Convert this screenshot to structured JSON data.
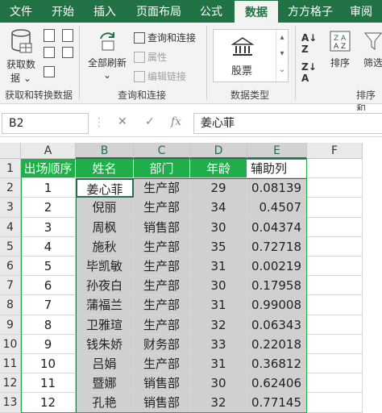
{
  "tabs": [
    "文件",
    "开始",
    "插入",
    "页面布局",
    "公式",
    "数据",
    "方方格子",
    "审阅"
  ],
  "active_tab": "数据",
  "ribbon": {
    "get_data_label1": "获取数",
    "get_data_label2": "据",
    "refresh_label": "全部刷新",
    "query_conn": "查询和连接",
    "properties": "属性",
    "edit_links": "编辑链接",
    "stock_label": "股票",
    "sort_label": "排序",
    "filter_label": "筛选",
    "group1": "获取和转换数据",
    "group2": "查询和连接",
    "group3": "数据类型",
    "group4": "排序和"
  },
  "formula_bar": {
    "name_box": "B2",
    "fx": "fx",
    "content": "姜心菲"
  },
  "columns": [
    "A",
    "B",
    "C",
    "D",
    "E",
    "F"
  ],
  "rows": [
    "1",
    "2",
    "3",
    "4",
    "5",
    "6",
    "7",
    "8",
    "9",
    "10",
    "11",
    "12",
    "13"
  ],
  "header_row": [
    "出场顺序",
    "姓名",
    "部门",
    "年龄",
    "辅助列"
  ],
  "data_rows": [
    [
      "1",
      "姜心菲",
      "生产部",
      "29",
      "0.08139"
    ],
    [
      "2",
      "倪丽",
      "生产部",
      "34",
      "0.4507"
    ],
    [
      "3",
      "周枫",
      "销售部",
      "30",
      "0.04374"
    ],
    [
      "4",
      "施秋",
      "生产部",
      "35",
      "0.72718"
    ],
    [
      "5",
      "毕凯敏",
      "生产部",
      "31",
      "0.00219"
    ],
    [
      "6",
      "孙夜白",
      "生产部",
      "30",
      "0.17958"
    ],
    [
      "7",
      "蒲福兰",
      "生产部",
      "31",
      "0.99008"
    ],
    [
      "8",
      "卫雅瑄",
      "生产部",
      "32",
      "0.06343"
    ],
    [
      "9",
      "钱朱娇",
      "财务部",
      "33",
      "0.22018"
    ],
    [
      "10",
      "吕娟",
      "生产部",
      "31",
      "0.36812"
    ],
    [
      "11",
      "暨娜",
      "销售部",
      "30",
      "0.62406"
    ],
    [
      "12",
      "孔艳",
      "销售部",
      "32",
      "0.77145"
    ]
  ],
  "colors": {
    "accent": "#217346",
    "header_green": "#1fae4a",
    "selection_shade": "#d0d0d0"
  }
}
